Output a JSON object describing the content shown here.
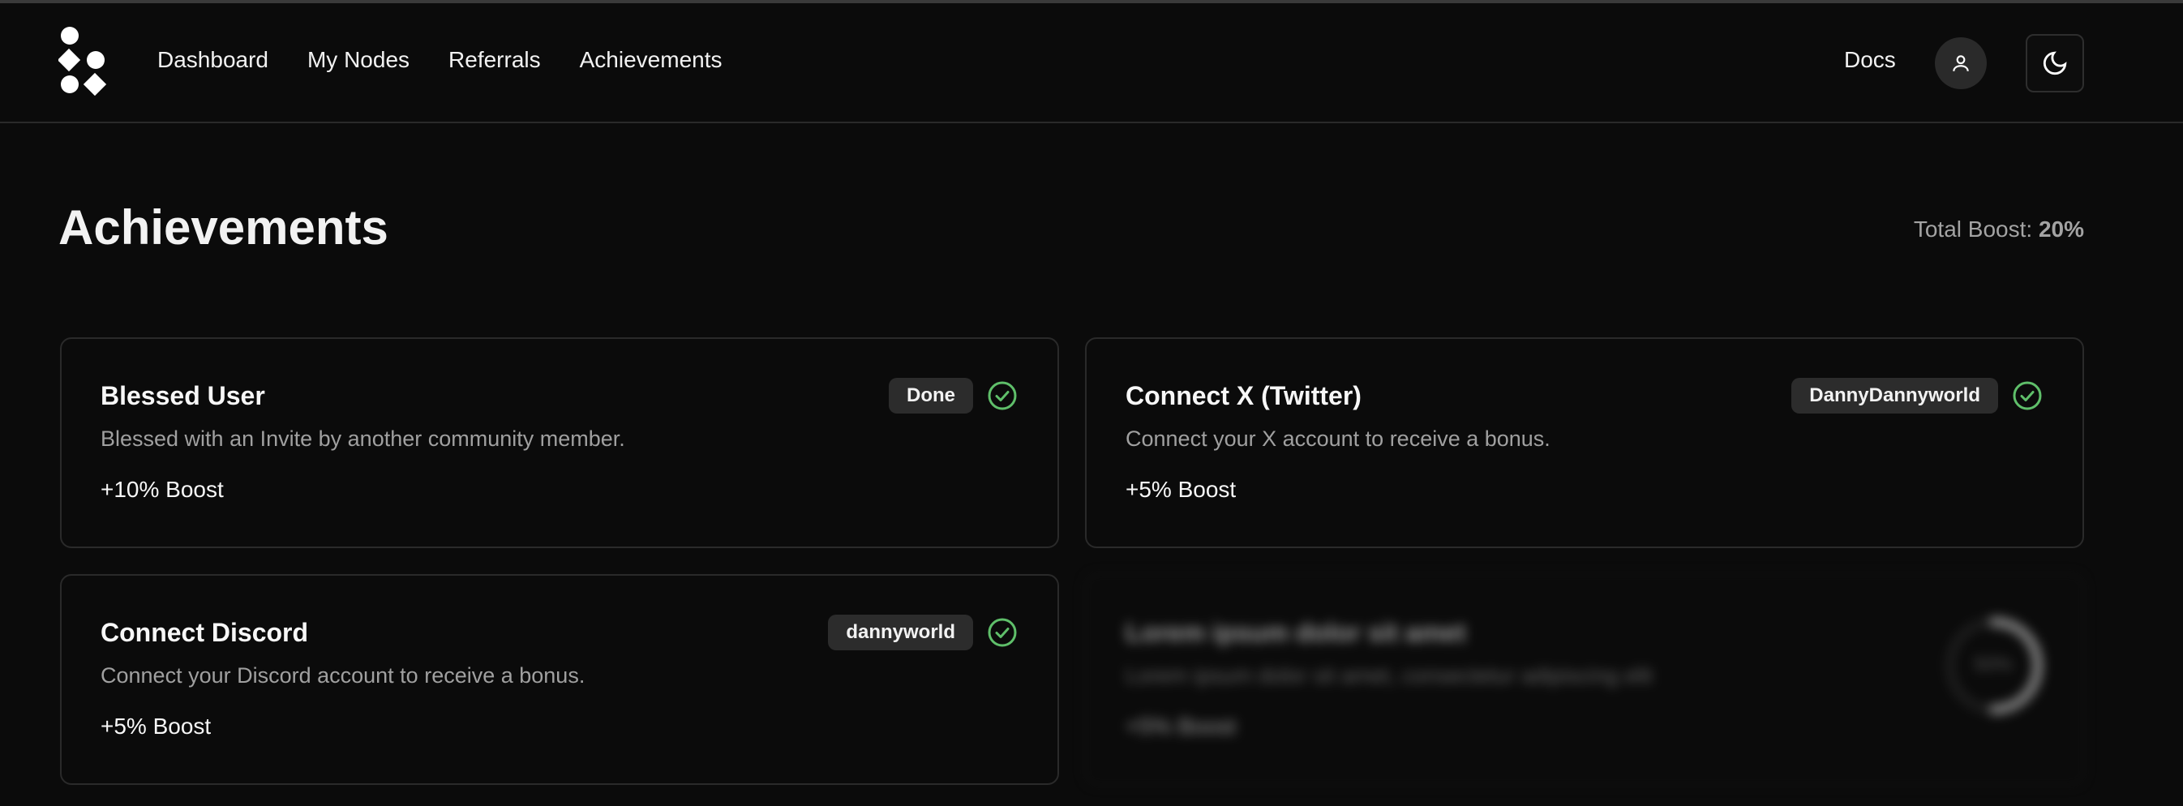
{
  "nav": {
    "items": [
      "Dashboard",
      "My Nodes",
      "Referrals",
      "Achievements"
    ],
    "docs": "Docs"
  },
  "page": {
    "title": "Achievements",
    "total_boost_label": "Total Boost:",
    "total_boost_value": "20%"
  },
  "cards": [
    {
      "title": "Blessed User",
      "description": "Blessed with an Invite by another community member.",
      "boost": "+10% Boost",
      "badge": "Done",
      "status": "complete"
    },
    {
      "title": "Connect X (Twitter)",
      "description": "Connect your X account to receive a bonus.",
      "boost": "+5% Boost",
      "badge": "DannyDannyworld",
      "status": "complete"
    },
    {
      "title": "Connect Discord",
      "description": "Connect your Discord account to receive a bonus.",
      "boost": "+5% Boost",
      "badge": "dannyworld",
      "status": "complete"
    },
    {
      "title": "Lorem ipsum dolor sit amet",
      "description": "Lorem ipsum dolor sit amet, consectetur adipiscing elit",
      "boost": "+5% Boost",
      "progress_label": "50%",
      "progress": 0.5,
      "status": "locked"
    }
  ],
  "colors": {
    "background": "#0b0b0b",
    "check_green": "#5fbf6a",
    "badge_bg": "#2c2c2c"
  }
}
